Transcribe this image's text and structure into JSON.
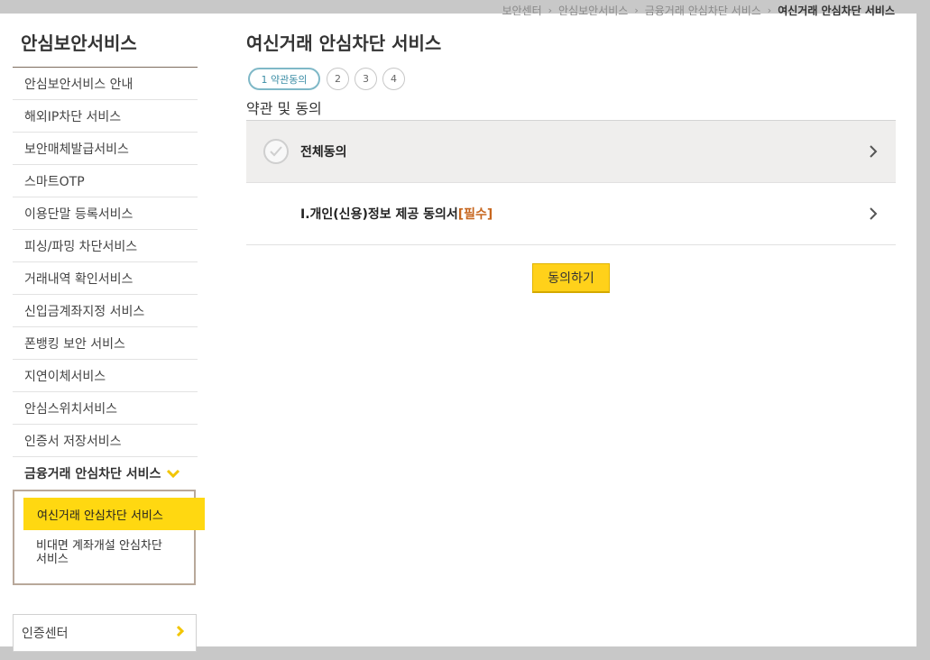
{
  "breadcrumb": {
    "items": [
      "보안센터",
      "안심보안서비스",
      "금융거래 안심차단 서비스"
    ],
    "current": "여신거래 안심차단 서비스",
    "separator": "›"
  },
  "sidebar": {
    "title": "안심보안서비스",
    "items": [
      {
        "label": "안심보안서비스 안내"
      },
      {
        "label": "해외IP차단 서비스"
      },
      {
        "label": "보안매체발급서비스"
      },
      {
        "label": "스마트OTP"
      },
      {
        "label": "이용단말 등록서비스"
      },
      {
        "label": "피싱/파밍 차단서비스"
      },
      {
        "label": "거래내역 확인서비스"
      },
      {
        "label": "신입금계좌지정 서비스"
      },
      {
        "label": "폰뱅킹 보안 서비스"
      },
      {
        "label": "지연이체서비스"
      },
      {
        "label": "안심스위치서비스"
      },
      {
        "label": "인증서 저장서비스"
      }
    ],
    "active_item": {
      "label": "금융거래 안심차단 서비스",
      "icon": "chevron-down-icon"
    },
    "submenu": [
      {
        "label": "여신거래 안심차단 서비스",
        "selected": true
      },
      {
        "label": "비대면 계좌개설 안심차단 서비스",
        "selected": false
      }
    ],
    "cert_box": {
      "label": "인증센터",
      "icon": "chevron-right-icon"
    }
  },
  "main": {
    "page_title": "여신거래 안심차단 서비스",
    "steps": [
      {
        "label": "1 약관동의",
        "current": true
      },
      {
        "label": "2",
        "current": false
      },
      {
        "label": "3",
        "current": false
      },
      {
        "label": "4",
        "current": false
      }
    ],
    "section_title": "약관 및 동의",
    "agreements": {
      "all": {
        "label": "전체동의",
        "icon": "check-circle-icon"
      },
      "items": [
        {
          "label": "I.개인(신용)정보 제공 동의서",
          "required_tag": "[필수]"
        }
      ]
    },
    "agree_button": "동의하기"
  },
  "colors": {
    "accent_yellow": "#ffd811",
    "step_active_border": "#7fb8c7",
    "required_text": "#c7661e",
    "sidebar_rule": "#7d6b5d"
  }
}
